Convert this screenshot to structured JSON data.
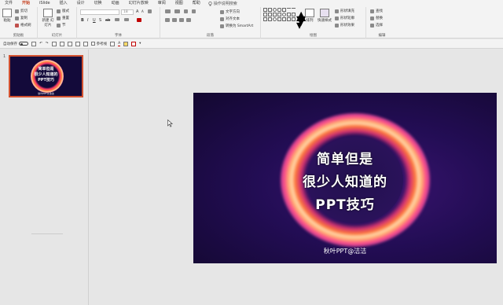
{
  "tabs": [
    "文件",
    "开始",
    "iSlide",
    "插入",
    "设计",
    "切换",
    "动画",
    "幻灯片放映",
    "审阅",
    "视图",
    "帮助"
  ],
  "active_tab": "开始",
  "tell_me": "操作说明搜索",
  "ribbon": {
    "clipboard": {
      "label": "剪贴板",
      "paste": "粘贴",
      "cut": "剪切",
      "copy": "复制",
      "format_painter": "格式刷"
    },
    "slides": {
      "label": "幻灯片",
      "new_slide": "新建 幻灯片",
      "layout": "版式",
      "reset": "重置",
      "section": "节"
    },
    "font": {
      "label": "字体",
      "font_name": "",
      "font_size": "18"
    },
    "paragraph": {
      "label": "段落",
      "text_direction": "文字方向",
      "align_text": "对齐文本",
      "smartart": "转换为 SmartArt"
    },
    "drawing": {
      "label": "绘图",
      "arrange": "排列",
      "quick_styles": "快速样式",
      "shape_fill": "形状填充",
      "shape_outline": "形状轮廓",
      "shape_effects": "形状效果"
    },
    "editing": {
      "label": "编辑",
      "find": "查找",
      "replace": "替换",
      "select": "选择"
    }
  },
  "qat": {
    "autosave": "自动保存",
    "autosave_state": "关",
    "guides": "参考线"
  },
  "thumbnails": [
    {
      "number": "1",
      "lines": [
        "简单但是",
        "很少人知道的",
        "PPT技巧"
      ],
      "footer": "秋叶PPT@洁洁"
    }
  ],
  "slide": {
    "title_lines": [
      "简单但是",
      "很少人知道的",
      "PPT技巧"
    ],
    "subtitle": "秋叶PPT@洁洁"
  }
}
